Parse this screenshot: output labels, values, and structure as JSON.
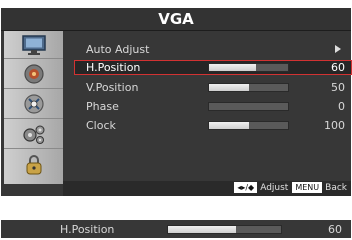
{
  "osd": {
    "title": "VGA",
    "menu_items": [
      {
        "label": "Auto Adjust",
        "value": "",
        "has_arrow": true,
        "bar": null,
        "selected": false
      },
      {
        "label": "H.Position",
        "value": "60",
        "has_arrow": false,
        "bar": 0.6,
        "selected": true
      },
      {
        "label": "V.Position",
        "value": "50",
        "has_arrow": false,
        "bar": 0.5,
        "selected": false
      },
      {
        "label": "Phase",
        "value": "0",
        "has_arrow": false,
        "bar": 0.0,
        "selected": false
      },
      {
        "label": "Clock",
        "value": "100",
        "has_arrow": false,
        "bar": 0.5,
        "selected": false
      }
    ],
    "sidebar_icons": [
      "monitor-icon",
      "speaker-icon",
      "satellite-icon",
      "gears-icon",
      "lock-icon"
    ],
    "footer": {
      "nav_glyph": "◂▸/◆",
      "adjust_label": "Adjust",
      "menu_key": "MENU",
      "back_label": "Back"
    }
  },
  "standalone_slider": {
    "label": "H.Position",
    "value": "60",
    "bar": 0.6
  },
  "colors": {
    "panel_bg": "#373737",
    "highlight_border": "#d23232",
    "bar_fill": "#e6e6e6"
  }
}
